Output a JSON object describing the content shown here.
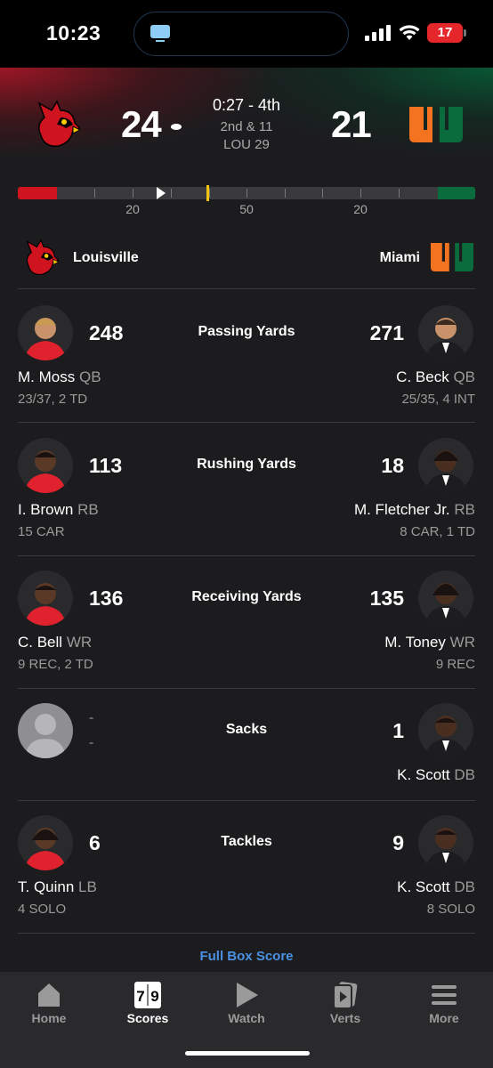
{
  "status_bar": {
    "time": "10:23",
    "battery": "17"
  },
  "game": {
    "away": {
      "name": "Louisville",
      "score": "24",
      "logo_icon": "cardinal-logo-icon",
      "color": "#d0141f"
    },
    "home": {
      "name": "Miami",
      "score": "21",
      "logo_icon": "miami-u-logo-icon",
      "color": "#0a6b3c"
    },
    "clock": "0:27 - 4th",
    "down_distance": "2nd & 11",
    "ball_on": "LOU 29",
    "field_labels": [
      "20",
      "50",
      "20"
    ]
  },
  "team_row": {
    "left": "Louisville",
    "right": "Miami"
  },
  "stats": [
    {
      "category": "Passing Yards",
      "left": {
        "value": "248",
        "name": "M. Moss",
        "pos": "QB",
        "line": "23/37, 2 TD"
      },
      "right": {
        "value": "271",
        "name": "C. Beck",
        "pos": "QB",
        "line": "25/35, 4 INT"
      }
    },
    {
      "category": "Rushing Yards",
      "left": {
        "value": "113",
        "name": "I. Brown",
        "pos": "RB",
        "line": "15 CAR"
      },
      "right": {
        "value": "18",
        "name": "M. Fletcher Jr.",
        "pos": "RB",
        "line": "8 CAR, 1 TD"
      }
    },
    {
      "category": "Receiving Yards",
      "left": {
        "value": "136",
        "name": "C. Bell",
        "pos": "WR",
        "line": "9 REC, 2 TD"
      },
      "right": {
        "value": "135",
        "name": "M. Toney",
        "pos": "WR",
        "line": "9 REC"
      }
    },
    {
      "category": "Sacks",
      "left": {
        "value": "-",
        "value2": "-"
      },
      "right": {
        "value": "1",
        "name": "K. Scott",
        "pos": "DB"
      }
    },
    {
      "category": "Tackles",
      "left": {
        "value": "6",
        "name": "T. Quinn",
        "pos": "LB",
        "line": "4 SOLO"
      },
      "right": {
        "value": "9",
        "name": "K. Scott",
        "pos": "DB",
        "line": "8 SOLO"
      }
    }
  ],
  "full_box_score": "Full Box Score",
  "tabs": [
    {
      "label": "Home",
      "icon": "home-icon"
    },
    {
      "label": "Scores",
      "icon": "scoreboard-icon",
      "active": true
    },
    {
      "label": "Watch",
      "icon": "play-icon"
    },
    {
      "label": "Verts",
      "icon": "verts-icon"
    },
    {
      "label": "More",
      "icon": "menu-icon"
    }
  ]
}
